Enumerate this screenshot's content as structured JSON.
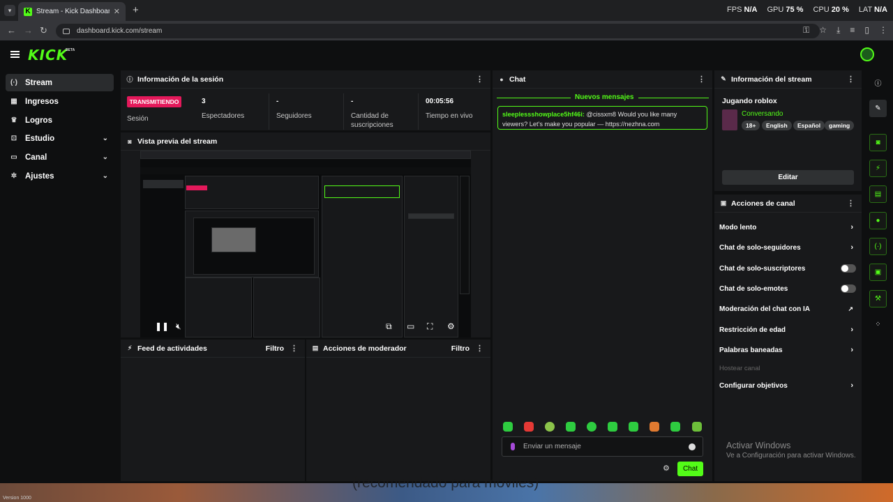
{
  "browser": {
    "tab_title": "Stream - Kick Dashboard",
    "url": "dashboard.kick.com/stream",
    "perf": {
      "fps_label": "FPS",
      "fps_value": "N/A",
      "gpu_label": "GPU",
      "gpu_value": "75 %",
      "cpu_label": "CPU",
      "cpu_value": "20 %",
      "lat_label": "LAT",
      "lat_value": "N/A"
    }
  },
  "header": {
    "logo": "KICK",
    "beta": "BETA"
  },
  "sidebar": {
    "items": [
      {
        "label": "Stream",
        "icon": "broadcast-icon"
      },
      {
        "label": "Ingresos",
        "icon": "money-icon"
      },
      {
        "label": "Logros",
        "icon": "trophy-icon"
      },
      {
        "label": "Estudio",
        "icon": "studio-icon"
      },
      {
        "label": "Canal",
        "icon": "channel-icon"
      },
      {
        "label": "Ajustes",
        "icon": "gear-icon"
      }
    ],
    "version": "Version 1000"
  },
  "session": {
    "title": "Información de la sesión",
    "badge": "TRANSMITIENDO",
    "status_label": "Sesión",
    "stats": [
      {
        "value": "3",
        "label": "Espectadores"
      },
      {
        "value": "-",
        "label": "Seguidores"
      },
      {
        "value": "-",
        "label": "Cantidad de suscripciones"
      },
      {
        "value": "00:05:56",
        "label": "Tiempo en vivo"
      }
    ]
  },
  "preview": {
    "title": "Vista previa del stream"
  },
  "activity": {
    "title": "Feed de actividades",
    "filter": "Filtro"
  },
  "moderator": {
    "title": "Acciones de moderador",
    "filter": "Filtro"
  },
  "chat": {
    "title": "Chat",
    "new_messages": "Nuevos mensajes",
    "message": {
      "user": "sleeplessshowplace5hf46i:",
      "text": " @cissxm8 Would you like many viewers? Let's make you popular — https://nezhna.com"
    },
    "input_placeholder": "Enviar un mensaje",
    "send_label": "Chat"
  },
  "stream_info": {
    "title": "Información del stream",
    "stream_title": "Jugando roblox",
    "category": "Conversando",
    "tags": [
      "18+",
      "English",
      "Español",
      "gaming"
    ],
    "edit_label": "Editar"
  },
  "channel_actions": {
    "title": "Acciones de canal",
    "items": [
      {
        "label": "Modo lento",
        "control": "arrow"
      },
      {
        "label": "Chat de solo-seguidores",
        "control": "arrow"
      },
      {
        "label": "Chat de solo-suscriptores",
        "control": "toggle-off"
      },
      {
        "label": "Chat de solo-emotes",
        "control": "toggle-off"
      },
      {
        "label": "Moderación del chat con IA",
        "control": "external"
      },
      {
        "label": "Restricción de edad",
        "control": "arrow"
      },
      {
        "label": "Palabras baneadas",
        "control": "arrow"
      },
      {
        "label": "Hostear canal",
        "control": "disabled"
      },
      {
        "label": "Configurar objetivos",
        "control": "arrow"
      }
    ]
  },
  "windows": {
    "activate_title": "Activar Windows",
    "activate_sub": "Ve a Configuración para activar Windows."
  },
  "caption": "(recomendado para móviles)",
  "colors": {
    "accent": "#53fc18",
    "live": "#e4195b",
    "panel": "#18191b",
    "bg": "#0e0f10"
  }
}
